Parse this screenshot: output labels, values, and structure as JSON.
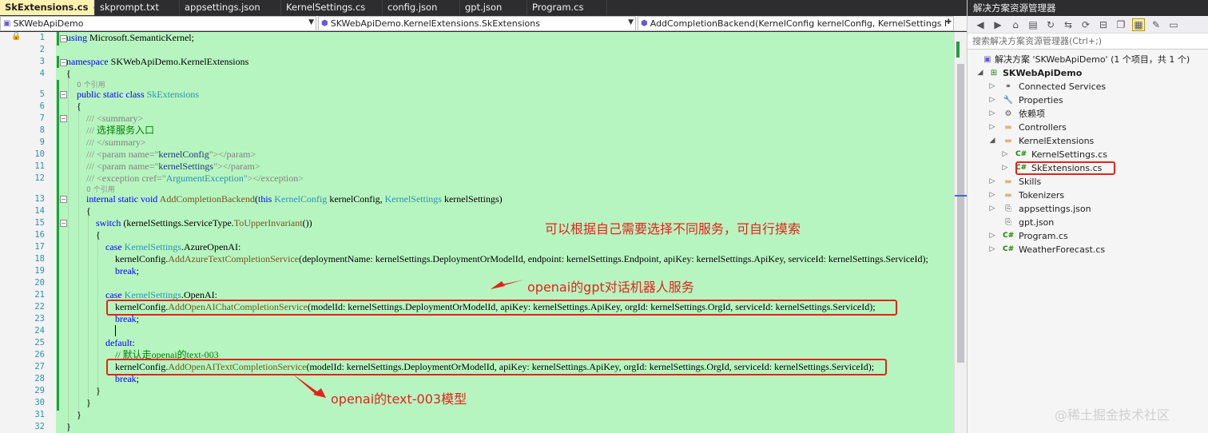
{
  "tabs": [
    {
      "label": "SkExtensions.cs",
      "active": true
    },
    {
      "label": "skprompt.txt"
    },
    {
      "label": "appsettings.json"
    },
    {
      "label": "KernelSettings.cs"
    },
    {
      "label": "config.json"
    },
    {
      "label": "gpt.json"
    },
    {
      "label": "Program.cs"
    }
  ],
  "navbar": {
    "project": "SKWebApiDemo",
    "type": "SKWebApiDemo.KernelExtensions.SkExtensions",
    "member": "AddCompletionBackend(KernelConfig kernelConfig, KernelSettings kernelS"
  },
  "line_numbers": [
    "1",
    "2",
    "3",
    "4",
    "5",
    "6",
    "7",
    "8",
    "9",
    "10",
    "11",
    "12",
    "13",
    "14",
    "15",
    "16",
    "17",
    "18",
    "19",
    "20",
    "21",
    "22",
    "23",
    "24",
    "25",
    "26",
    "27",
    "28",
    "29",
    "30",
    "31",
    "32"
  ],
  "ref_label": "0 个引用",
  "code": {
    "l1": [
      "using",
      " Microsoft.SemanticKernel;"
    ],
    "l3": [
      "namespace",
      " SKWebApiDemo.KernelExtensions"
    ],
    "l4": "{",
    "l5": [
      "public static class",
      " ",
      "SkExtensions"
    ],
    "l6": "{",
    "l7": "/// <summary>",
    "l8": [
      "/// ",
      "选择服务入口"
    ],
    "l9": "/// </summary>",
    "l10": [
      "/// <param name=\"",
      "kernelConfig",
      "\"></param>"
    ],
    "l11": [
      "/// <param name=\"",
      "kernelSettings",
      "\"></param>"
    ],
    "l12": [
      "/// <exception cref=\"",
      "ArgumentException",
      "\"></exception>"
    ],
    "l13": [
      "internal static void",
      " ",
      "AddCompletionBackend",
      "(",
      "this",
      " ",
      "KernelConfig",
      " kernelConfig, ",
      "KernelSettings",
      " kernelSettings)"
    ],
    "l14": "{",
    "l15": [
      "switch",
      " (kernelSettings.ServiceType.",
      "ToUpperInvariant",
      "())"
    ],
    "l16": "{",
    "l17": [
      "case",
      " ",
      "KernelSettings",
      ".AzureOpenAI:"
    ],
    "l18": [
      "kernelConfig.",
      "AddAzureTextCompletionService",
      "(deploymentName: kernelSettings.DeploymentOrModelId, endpoint: kernelSettings.Endpoint, apiKey: kernelSettings.ApiKey, serviceId: kernelSettings.ServiceId);"
    ],
    "l19": [
      "break",
      ";"
    ],
    "l21": [
      "case",
      " ",
      "KernelSettings",
      ".OpenAI:"
    ],
    "l22": [
      "kernelConfig.",
      "AddOpenAIChatCompletionService",
      "(modelId: kernelSettings.DeploymentOrModelId, apiKey: kernelSettings.ApiKey, orgId: kernelSettings.OrgId, serviceId: kernelSettings.ServiceId);"
    ],
    "l23": [
      "break",
      ";"
    ],
    "l25": [
      "default",
      ":"
    ],
    "l26": "// 默认走openai的text-003",
    "l27": [
      "kernelConfig.",
      "AddOpenAITextCompletionService",
      "(modelId: kernelSettings.DeploymentOrModelId, apiKey: kernelSettings.ApiKey, orgId: kernelSettings.OrgId, serviceId: kernelSettings.ServiceId);"
    ],
    "l28": [
      "break",
      ";"
    ],
    "l29": "}",
    "l30": "}",
    "l31": "}",
    "l32": "}"
  },
  "annotations": {
    "a1": "可以根据自己需要选择不同服务，可自行摸索",
    "a2": "openai的gpt对话机器人服务",
    "a3": "openai的text-003模型"
  },
  "solution": {
    "title": "解决方案资源管理器",
    "search_placeholder": "搜索解决方案资源管理器(Ctrl+;)",
    "root": "解决方案 'SKWebApiDemo' (1 个项目，共 1 个)",
    "project": "SKWebApiDemo",
    "items": [
      {
        "label": "Connected Services",
        "icon": "connected-services-icon"
      },
      {
        "label": "Properties",
        "icon": "wrench-icon"
      },
      {
        "label": "依赖项",
        "icon": "dependencies-icon"
      },
      {
        "label": "Controllers",
        "icon": "folder-icon"
      },
      {
        "label": "KernelExtensions",
        "icon": "folder-open-icon"
      },
      {
        "label": "KernelSettings.cs",
        "icon": "csharp-file-icon"
      },
      {
        "label": "SkExtensions.cs",
        "icon": "csharp-file-icon"
      },
      {
        "label": "Skills",
        "icon": "folder-icon"
      },
      {
        "label": "Tokenizers",
        "icon": "folder-icon"
      },
      {
        "label": "appsettings.json",
        "icon": "json-file-icon"
      },
      {
        "label": "gpt.json",
        "icon": "json-file-icon"
      },
      {
        "label": "Program.cs",
        "icon": "csharp-file-icon"
      },
      {
        "label": "WeatherForecast.cs",
        "icon": "csharp-file-icon"
      }
    ],
    "csharp_glyph": "C#"
  },
  "watermark": "@稀土掘金技术社区",
  "colors": {
    "annotation": "#e3231b",
    "diff_green": "#1fa03c",
    "editor_bg": "#b7f5c0"
  }
}
